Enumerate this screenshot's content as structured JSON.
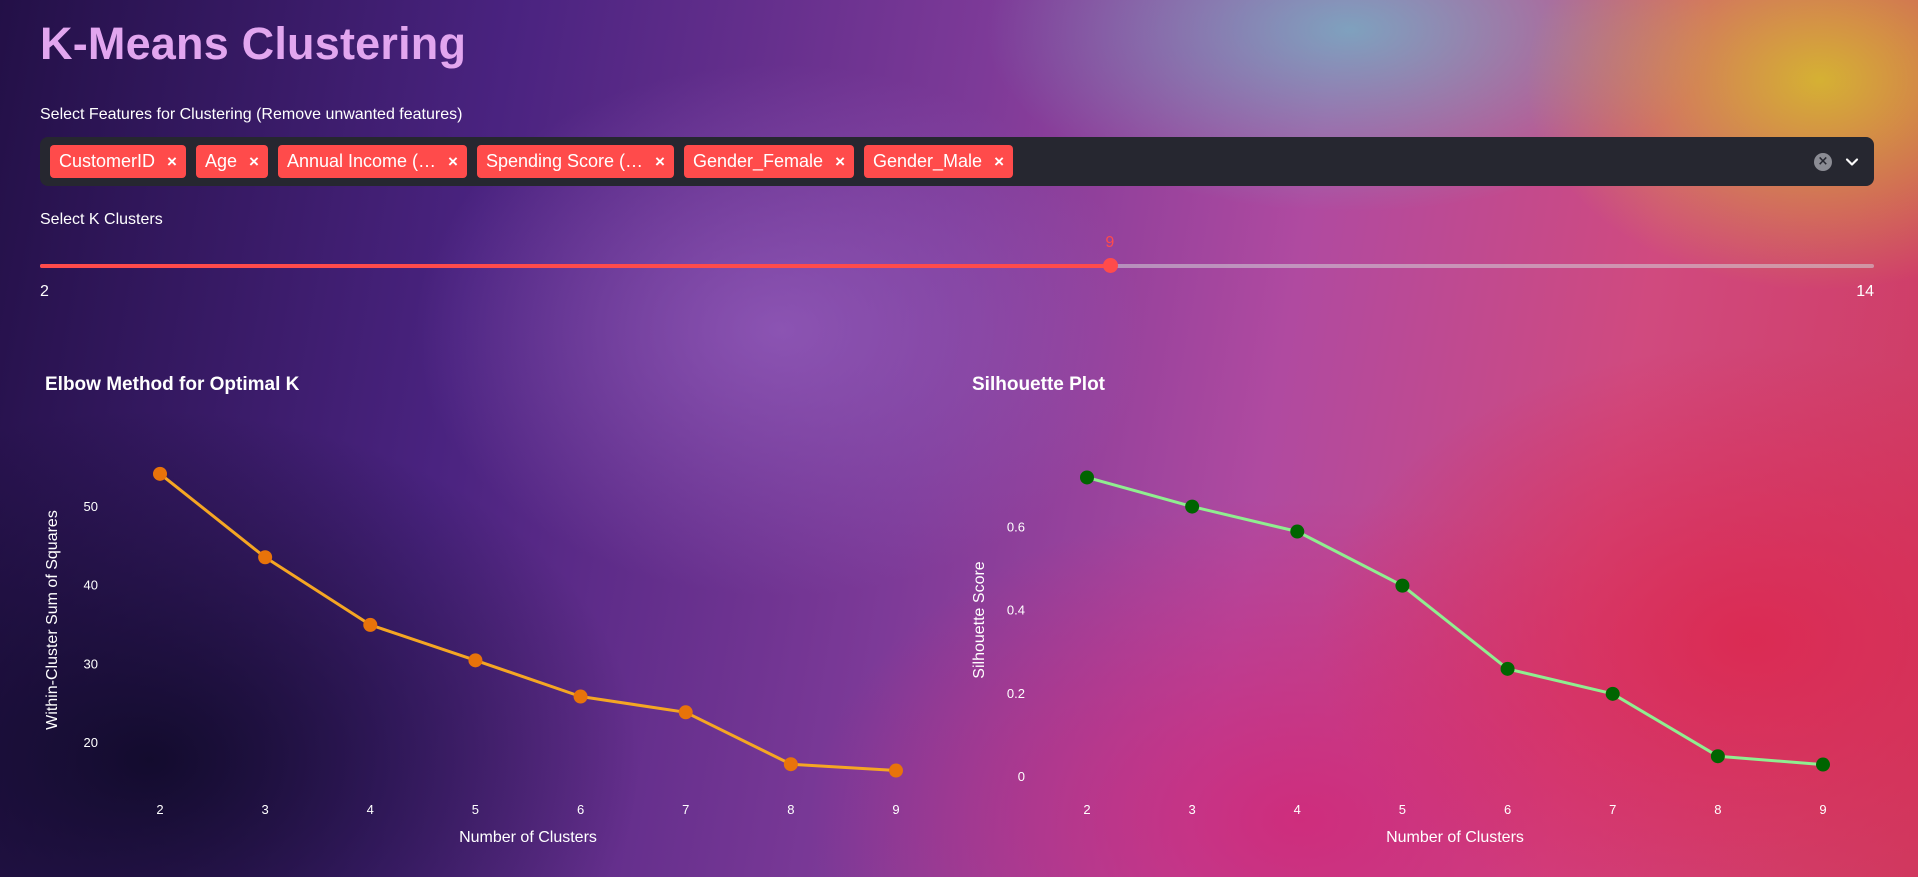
{
  "page": {
    "title": "K-Means Clustering"
  },
  "features": {
    "label": "Select Features for Clustering (Remove unwanted features)",
    "selected": [
      "CustomerID",
      "Age",
      "Annual Income (…",
      "Spending Score (…",
      "Gender_Female",
      "Gender_Male"
    ],
    "remove_symbol": "×",
    "clear_symbol": "×",
    "tag_color": "#ff4b4b"
  },
  "k_slider": {
    "label": "Select K Clusters",
    "min": 2,
    "max": 14,
    "value": 9,
    "accent_color": "#ff4b4b"
  },
  "chart_data": [
    {
      "type": "line",
      "title": "Elbow Method for Optimal K",
      "xlabel": "Number of Clusters",
      "ylabel": "Within-Cluster Sum of Squares",
      "x": [
        2,
        3,
        4,
        5,
        6,
        7,
        8,
        9
      ],
      "y": [
        54.2,
        43.6,
        35.0,
        30.5,
        25.9,
        23.9,
        17.3,
        16.5
      ],
      "yticks": [
        20,
        30,
        40,
        50
      ],
      "ylim": [
        12.5,
        58.5
      ],
      "line_color": "#f5a623",
      "marker_color": "#e8730a",
      "grid": false
    },
    {
      "type": "line",
      "title": "Silhouette Plot",
      "xlabel": "Number of Clusters",
      "ylabel": "Silhouette Score",
      "x": [
        2,
        3,
        4,
        5,
        6,
        7,
        8,
        9
      ],
      "y": [
        0.72,
        0.65,
        0.59,
        0.46,
        0.26,
        0.2,
        0.05,
        0.03
      ],
      "yticks": [
        0,
        0.2,
        0.4,
        0.6
      ],
      "yticklabels": [
        "0",
        "0.2",
        "0.4",
        "0.6"
      ],
      "ylim": [
        -0.06,
        0.81
      ],
      "line_color": "#90ee90",
      "marker_color": "#006400",
      "grid": false
    }
  ]
}
